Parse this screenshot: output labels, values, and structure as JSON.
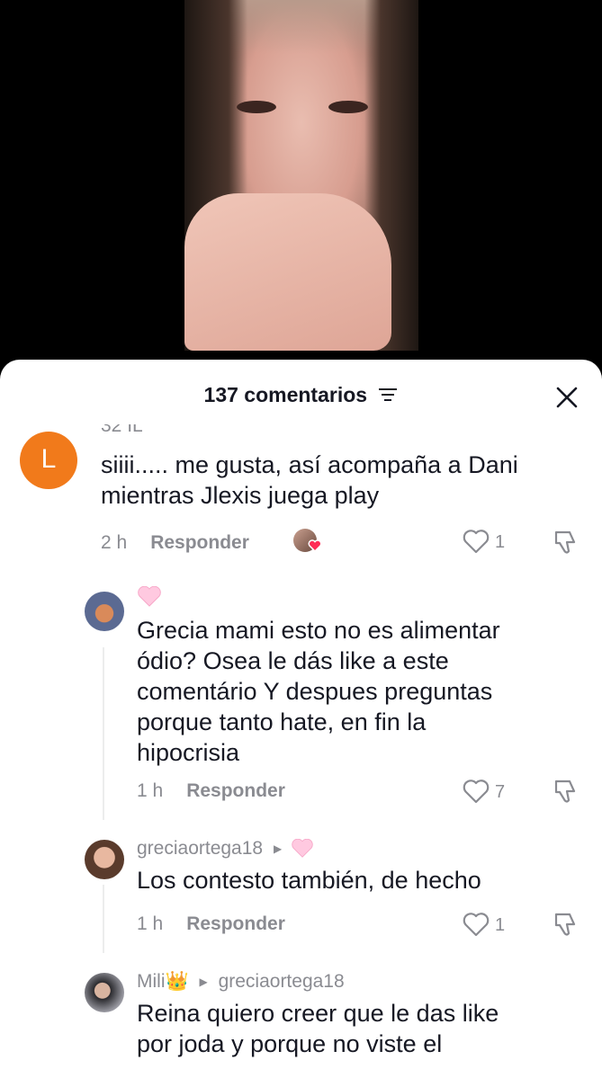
{
  "colors": {
    "accent": "#fe2c55",
    "text": "#161823",
    "muted": "#8a8b91",
    "avatar_l": "#f17a1b"
  },
  "header": {
    "title": "137 comentarios",
    "filter_icon": "filter-lines-icon",
    "close_icon": "close-icon"
  },
  "comments": [
    {
      "cutoff_text": "32 IL",
      "avatar_letter": "L",
      "text_lines": [
        "siiii..... me gusta, así acompaña a Dani",
        "mientras Jlexis juega play"
      ],
      "time": "2 h",
      "reply": "Responder",
      "likes": "1"
    },
    {
      "text_lines": [
        "Grecia mami esto no es alimentar",
        "ódio? Osea le dás like a este",
        "comentário Y despues preguntas",
        "porque tanto hate, en fin la",
        "hipocrisia"
      ],
      "time": "1 h",
      "reply": "Responder",
      "likes": "7"
    },
    {
      "username": "greciaortega18",
      "text_lines": [
        "Los contesto también, de hecho"
      ],
      "time": "1 h",
      "reply": "Responder",
      "likes": "1"
    },
    {
      "username": "Mili👑",
      "reply_to": "greciaortega18",
      "text_lines": [
        "Reina quiero creer que le das like",
        "por joda y porque no viste el"
      ]
    }
  ]
}
